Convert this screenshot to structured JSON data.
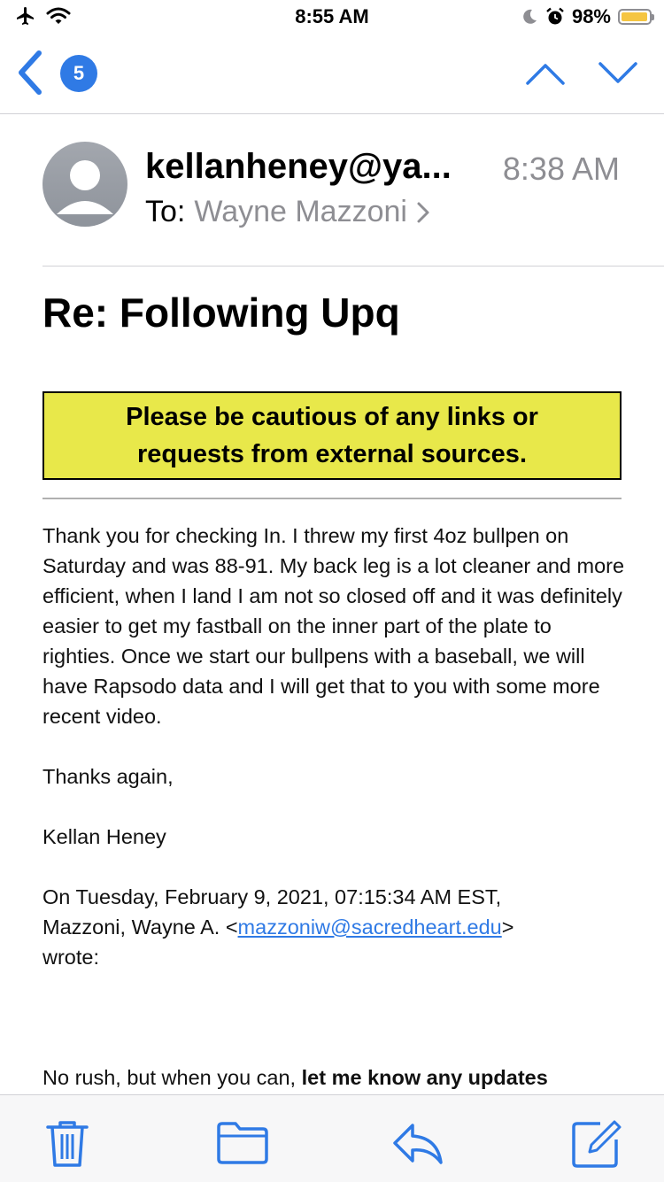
{
  "status_bar": {
    "time": "8:55 AM",
    "battery_percent": "98%",
    "battery_level": 0.98,
    "icons": [
      "airplane-icon",
      "wifi-icon",
      "moon-icon",
      "alarm-icon",
      "battery-icon"
    ]
  },
  "nav": {
    "unread_count": "5",
    "icons": [
      "back-chevron-icon",
      "chevron-up-icon",
      "chevron-down-icon"
    ]
  },
  "email": {
    "from": "kellanheney@ya...",
    "time": "8:38 AM",
    "to_label": "To:",
    "to_name": "Wayne Mazzoni",
    "subject": "Re: Following Upq",
    "warning_line1": "Please be cautious of any links or",
    "warning_line2": "requests from external sources.",
    "body_paragraph": "Thank you for checking In. I threw my first 4oz bullpen on Saturday and was 88-91. My back leg is a lot cleaner and more efficient, when I land I am not so closed off and it was definitely easier to get my fastball on the inner part of the plate to righties. Once we start our bullpens with a baseball, we will have Rapsodo data and I will get that to you with some more recent video.",
    "thanks": "Thanks again,",
    "signature": "Kellan Heney",
    "quote_header": "On Tuesday, February 9, 2021, 07:15:34 AM EST,",
    "quote_sender": "Mazzoni, Wayne A.",
    "quote_open": "<",
    "quote_email": "mazzoniw@sacredheart.edu",
    "quote_close": ">",
    "quote_wrote": "wrote:",
    "quoted_text_start": "No rush, but when you can, ",
    "quoted_text_bold": "let me know any updates"
  },
  "toolbar": {
    "icons": [
      "trash-icon",
      "folder-icon",
      "reply-icon",
      "compose-icon"
    ]
  },
  "colors": {
    "accent": "#2f7ae5",
    "warning_bg": "#e8e84a",
    "battery": "#f5c542",
    "secondary_text": "#8e8e93"
  }
}
